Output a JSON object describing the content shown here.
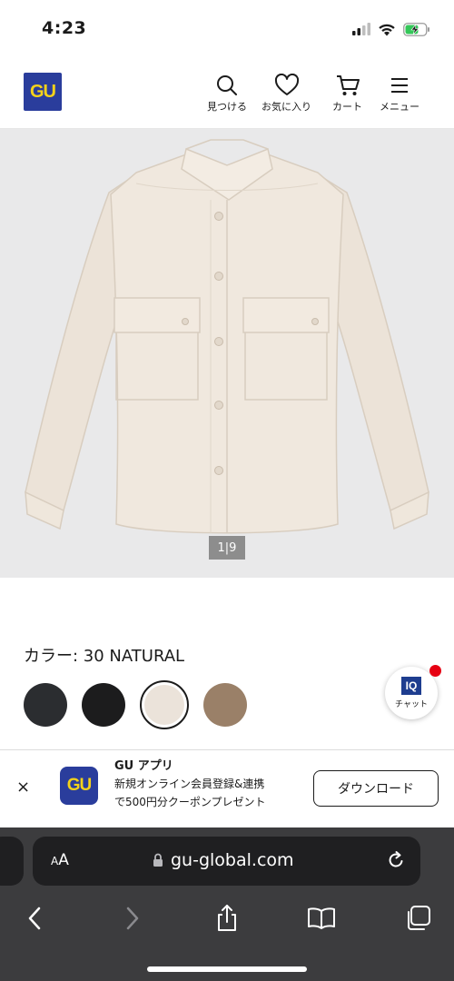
{
  "status": {
    "time": "4:23",
    "battery_color": "#34c759"
  },
  "header": {
    "logo_text": "GU",
    "logo_bg": "#2a3d9c",
    "logo_fg": "#f4d21a",
    "nav": [
      {
        "label": "見つける",
        "icon": "search-icon"
      },
      {
        "label": "お気に入り",
        "icon": "heart-icon"
      },
      {
        "label": "カート",
        "icon": "cart-icon"
      },
      {
        "label": "メニュー",
        "icon": "menu-icon"
      }
    ]
  },
  "product": {
    "image_counter": "1|9",
    "color_label": "カラー:  30 NATURAL",
    "swatches": [
      {
        "name": "dark-gray",
        "color": "#2b2d30"
      },
      {
        "name": "black",
        "color": "#1c1c1d"
      },
      {
        "name": "natural",
        "color": "#ebe3da",
        "selected": true
      },
      {
        "name": "brown",
        "color": "#9a8068"
      }
    ]
  },
  "chat": {
    "icon_text": "IQ",
    "label": "チャット"
  },
  "app_banner": {
    "close": "×",
    "logo_text": "GU",
    "title": "GU アプリ",
    "desc_line1": "新規オンライン会員登録&連携",
    "desc_line2": "で500円分クーポンプレゼント",
    "button": "ダウンロード"
  },
  "browser": {
    "aa_small": "A",
    "aa_big": "A",
    "url": "gu-global.com",
    "toolbar": [
      "back-icon",
      "forward-icon",
      "share-icon",
      "bookmarks-icon",
      "tabs-icon"
    ]
  }
}
